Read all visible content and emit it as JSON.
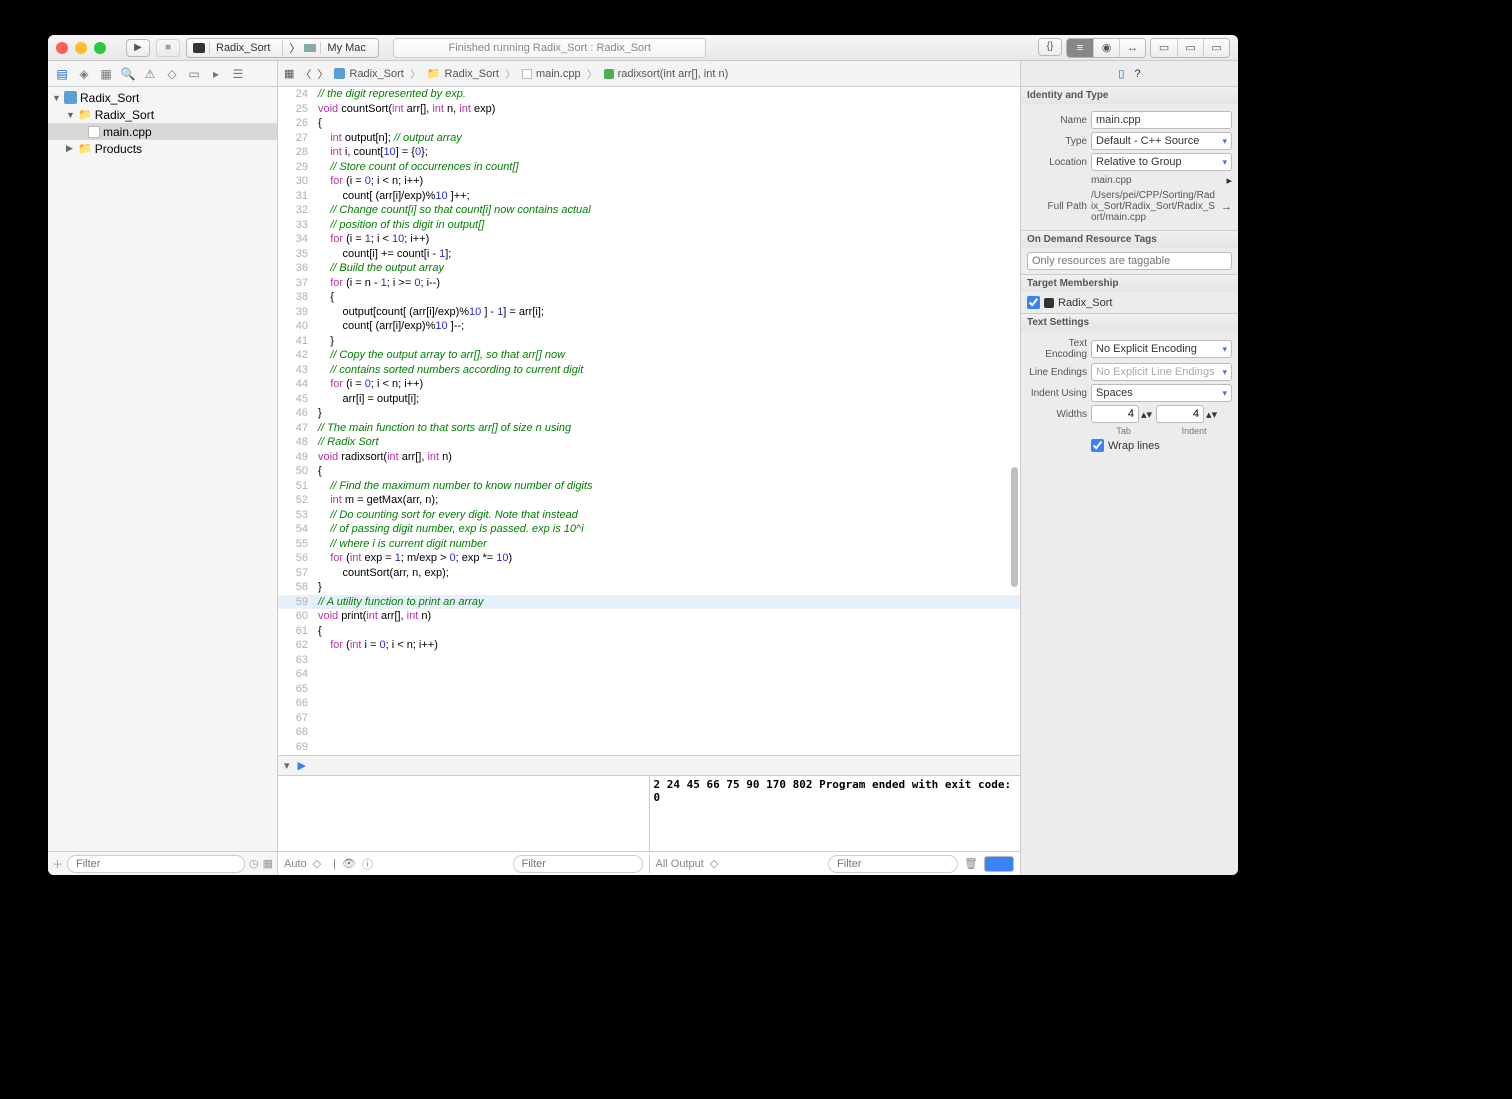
{
  "titlebar": {
    "scheme_name": "Radix_Sort",
    "scheme_device": "My Mac",
    "status": "Finished running Radix_Sort : Radix_Sort"
  },
  "navigator": {
    "root": "Radix_Sort",
    "group": "Radix_Sort",
    "file": "main.cpp",
    "products": "Products",
    "filter_placeholder": "Filter"
  },
  "jumpbar": {
    "project": "Radix_Sort",
    "folder": "Radix_Sort",
    "file": "main.cpp",
    "symbol": "radixsort(int arr[], int n)"
  },
  "editor": {
    "first_line_no": 24,
    "highlighted_line": 59,
    "lines": [
      {
        "n": 24,
        "t": "<span class='cm'>// the digit represented by exp.</span>"
      },
      {
        "n": 25,
        "t": "<span class='kw'>void</span> countSort(<span class='kw'>int</span> arr[], <span class='kw'>int</span> n, <span class='kw'>int</span> exp)"
      },
      {
        "n": 26,
        "t": "{"
      },
      {
        "n": 27,
        "t": "    <span class='kw'>int</span> output[n]; <span class='cm'>// output array</span>"
      },
      {
        "n": 28,
        "t": "    <span class='kw'>int</span> i, count[<span class='num'>10</span>] = {<span class='num'>0</span>};"
      },
      {
        "n": 29,
        "t": ""
      },
      {
        "n": 30,
        "t": "    <span class='cm'>// Store count of occurrences in count[]</span>"
      },
      {
        "n": 31,
        "t": "    <span class='kw'>for</span> (i = <span class='num'>0</span>; i &lt; n; i++)"
      },
      {
        "n": 32,
        "t": "        count[ (arr[i]/exp)%<span class='num'>10</span> ]++;"
      },
      {
        "n": 33,
        "t": ""
      },
      {
        "n": 34,
        "t": "    <span class='cm'>// Change count[i] so that count[i] now contains actual</span>"
      },
      {
        "n": 35,
        "t": "    <span class='cm'>// position of this digit in output[]</span>"
      },
      {
        "n": 36,
        "t": "    <span class='kw'>for</span> (i = <span class='num'>1</span>; i &lt; <span class='num'>10</span>; i++)"
      },
      {
        "n": 37,
        "t": "        count[i] += count[i - <span class='num'>1</span>];"
      },
      {
        "n": 38,
        "t": ""
      },
      {
        "n": 39,
        "t": "    <span class='cm'>// Build the output array</span>"
      },
      {
        "n": 40,
        "t": "    <span class='kw'>for</span> (i = n - <span class='num'>1</span>; i &gt;= <span class='num'>0</span>; i--)"
      },
      {
        "n": 41,
        "t": "    {"
      },
      {
        "n": 42,
        "t": "        output[count[ (arr[i]/exp)%<span class='num'>10</span> ] - <span class='num'>1</span>] = arr[i];"
      },
      {
        "n": 43,
        "t": "        count[ (arr[i]/exp)%<span class='num'>10</span> ]--;"
      },
      {
        "n": 44,
        "t": "    }"
      },
      {
        "n": 45,
        "t": ""
      },
      {
        "n": 46,
        "t": "    <span class='cm'>// Copy the output array to arr[], so that arr[] now</span>"
      },
      {
        "n": 47,
        "t": "    <span class='cm'>// contains sorted numbers according to current digit</span>"
      },
      {
        "n": 48,
        "t": "    <span class='kw'>for</span> (i = <span class='num'>0</span>; i &lt; n; i++)"
      },
      {
        "n": 49,
        "t": "        arr[i] = output[i];"
      },
      {
        "n": 50,
        "t": "}"
      },
      {
        "n": 51,
        "t": ""
      },
      {
        "n": 52,
        "t": "<span class='cm'>// The main function to that sorts arr[] of size n using</span>"
      },
      {
        "n": 53,
        "t": "<span class='cm'>// Radix Sort</span>"
      },
      {
        "n": 54,
        "t": "<span class='kw'>void</span> radixsort(<span class='kw'>int</span> arr[], <span class='kw'>int</span> n)"
      },
      {
        "n": 55,
        "t": "{"
      },
      {
        "n": 56,
        "t": "    <span class='cm'>// Find the maximum number to know number of digits</span>"
      },
      {
        "n": 57,
        "t": "    <span class='kw'>int</span> m = getMax(arr, n);"
      },
      {
        "n": 58,
        "t": ""
      },
      {
        "n": 59,
        "t": "    <span class='cm'>// Do counting sort for every digit. Note that instead</span>"
      },
      {
        "n": 60,
        "t": "    <span class='cm'>// of passing digit number, exp is passed. exp is 10^i</span>"
      },
      {
        "n": 61,
        "t": "    <span class='cm'>// where i is current digit number</span>"
      },
      {
        "n": 62,
        "t": "    <span class='kw'>for</span> (<span class='kw'>int</span> exp = <span class='num'>1</span>; m/exp &gt; <span class='num'>0</span>; exp *= <span class='num'>10</span>)"
      },
      {
        "n": 63,
        "t": "        countSort(arr, n, exp);"
      },
      {
        "n": 64,
        "t": "}"
      },
      {
        "n": 65,
        "t": ""
      },
      {
        "n": 66,
        "t": "<span class='cm'>// A utility function to print an array</span>"
      },
      {
        "n": 67,
        "t": "<span class='kw'>void</span> print(<span class='kw'>int</span> arr[], <span class='kw'>int</span> n)"
      },
      {
        "n": 68,
        "t": "{"
      },
      {
        "n": 69,
        "t": "    <span class='kw'>for</span> (<span class='kw'>int</span> i = <span class='num'>0</span>; i &lt; n; i++)"
      }
    ]
  },
  "debug": {
    "auto_label": "Auto",
    "console_output": "2 24 45 66 75 90 170 802 Program ended with exit code: 0",
    "all_output": "All Output",
    "filter_placeholder": "Filter"
  },
  "inspector": {
    "identity_title": "Identity and Type",
    "name_label": "Name",
    "name_value": "main.cpp",
    "type_label": "Type",
    "type_value": "Default - C++ Source",
    "location_label": "Location",
    "location_value": "Relative to Group",
    "location_file": "main.cpp",
    "fullpath_label": "Full Path",
    "fullpath_value": "/Users/pei/CPP/Sorting/Radix_Sort/Radix_Sort/Radix_Sort/main.cpp",
    "ondemand_title": "On Demand Resource Tags",
    "ondemand_placeholder": "Only resources are taggable",
    "target_title": "Target Membership",
    "target_name": "Radix_Sort",
    "text_title": "Text Settings",
    "encoding_label": "Text Encoding",
    "encoding_value": "No Explicit Encoding",
    "lineend_label": "Line Endings",
    "lineend_value": "No Explicit Line Endings",
    "indent_label": "Indent Using",
    "indent_value": "Spaces",
    "widths_label": "Widths",
    "tab_width": "4",
    "indent_width": "4",
    "tab_caption": "Tab",
    "indent_caption": "Indent",
    "wrap_label": "Wrap lines"
  }
}
